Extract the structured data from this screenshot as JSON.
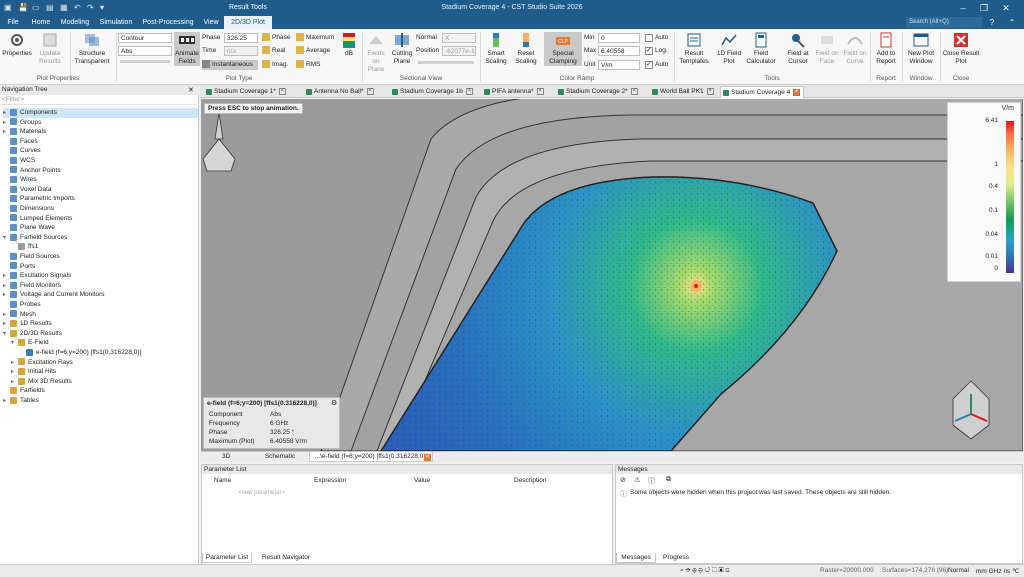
{
  "app": {
    "title": "Stadium Coverage 4 - CST Studio Suite 2026",
    "context_tab_group": "Result Tools",
    "search_placeholder": "Search (Alt+Q)"
  },
  "ribbon_tabs": [
    "File",
    "Home",
    "Modeling",
    "Simulation",
    "Post-Processing",
    "View",
    "2D/3D Plot"
  ],
  "ribbon": {
    "plot_properties": {
      "label": "Plot Properties",
      "properties": "Properties",
      "update_results": "Update Results"
    },
    "structure_transparent": "Structure Transparent",
    "contour_select": "Contour",
    "abs_select": "Abs",
    "animate_fields": "Animate Fields",
    "phase_label": "Phase",
    "phase_value": "326.25",
    "time_label": "Time",
    "time_value": "n/a",
    "instantaneous": "Instantaneous",
    "plot_type": {
      "label": "Plot Type",
      "phase": "Phase",
      "real": "Real",
      "imag": "Imag.",
      "maximum": "Maximum",
      "average": "Average",
      "rms": "RMS",
      "db": "dB"
    },
    "sectional_view": {
      "label": "Sectional View",
      "fields_on_plane": "Fields on Plane",
      "cutting_plane": "Cutting Plane",
      "normal_label": "Normal",
      "normal_value": "X",
      "position_label": "Position",
      "position_value": "-62077e-11"
    },
    "color_ramp": {
      "label": "Color Ramp",
      "smart_scaling": "Smart Scaling",
      "reset_scaling": "Reset Scaling",
      "special_clamping": "Special Clamping",
      "min_label": "Min",
      "min_value": "0",
      "max_label": "Max",
      "max_value": "6.40558",
      "unit_label": "Unit",
      "unit_value": "V/m",
      "auto1": "Auto",
      "log": "Log.",
      "auto2": "Auto"
    },
    "tools": {
      "label": "Tools",
      "result_templates": "Result Templates",
      "field_1d_plot": "1D Field Plot",
      "field_calculator": "Field Calculator",
      "field_at_cursor": "Field at Cursor",
      "field_on_face": "Field on Face",
      "field_on_curve": "Field on Curve"
    },
    "report": {
      "label": "Report",
      "add_to_report": "Add to Report"
    },
    "window": {
      "label": "Window",
      "new_plot_window": "New Plot Window"
    },
    "close": {
      "label": "Close",
      "close_result_plot": "Close Result Plot"
    }
  },
  "nav": {
    "title": "Navigation Tree",
    "filter": "<Filter>",
    "items": [
      {
        "label": "Components",
        "level": 0,
        "exp": "▸",
        "sel": true,
        "color": "#5b8fc9"
      },
      {
        "label": "Groups",
        "level": 0,
        "exp": "▸",
        "color": "#5b8fc9"
      },
      {
        "label": "Materials",
        "level": 0,
        "exp": "▸",
        "color": "#5b8fc9"
      },
      {
        "label": "Faces",
        "level": 0,
        "exp": "",
        "color": "#5b8fc9"
      },
      {
        "label": "Curves",
        "level": 0,
        "exp": "",
        "color": "#5b8fc9"
      },
      {
        "label": "WCS",
        "level": 0,
        "exp": "",
        "color": "#5b8fc9"
      },
      {
        "label": "Anchor Points",
        "level": 0,
        "exp": "",
        "color": "#5b8fc9"
      },
      {
        "label": "Wires",
        "level": 0,
        "exp": "",
        "color": "#5b8fc9"
      },
      {
        "label": "Voxel Data",
        "level": 0,
        "exp": "",
        "color": "#5b8fc9"
      },
      {
        "label": "Parametric Imports",
        "level": 0,
        "exp": "",
        "color": "#5b8fc9"
      },
      {
        "label": "Dimensions",
        "level": 0,
        "exp": "",
        "color": "#5b8fc9"
      },
      {
        "label": "Lumped Elements",
        "level": 0,
        "exp": "",
        "color": "#5b8fc9"
      },
      {
        "label": "Plane Wave",
        "level": 0,
        "exp": "",
        "color": "#5b8fc9"
      },
      {
        "label": "Farfield Sources",
        "level": 0,
        "exp": "▾",
        "color": "#5b8fc9"
      },
      {
        "label": "ffs1",
        "level": 1,
        "exp": "",
        "color": "#9a9a9a"
      },
      {
        "label": "Field Sources",
        "level": 0,
        "exp": "",
        "color": "#5b8fc9"
      },
      {
        "label": "Ports",
        "level": 0,
        "exp": "",
        "color": "#5b8fc9"
      },
      {
        "label": "Excitation Signals",
        "level": 0,
        "exp": "▸",
        "color": "#5b8fc9"
      },
      {
        "label": "Field Monitors",
        "level": 0,
        "exp": "▸",
        "color": "#5b8fc9"
      },
      {
        "label": "Voltage and Current Monitors",
        "level": 0,
        "exp": "▸",
        "color": "#5b8fc9"
      },
      {
        "label": "Probes",
        "level": 0,
        "exp": "",
        "color": "#5b8fc9"
      },
      {
        "label": "Mesh",
        "level": 0,
        "exp": "▸",
        "color": "#5b8fc9"
      },
      {
        "label": "1D Results",
        "level": 0,
        "exp": "▸",
        "color": "#d9a43b"
      },
      {
        "label": "2D/3D Results",
        "level": 0,
        "exp": "▾",
        "color": "#d9a43b"
      },
      {
        "label": "E-Field",
        "level": 1,
        "exp": "▾",
        "color": "#d9a43b"
      },
      {
        "label": "e-field (f=6;y=200) [ffs1(0.316228,0)]",
        "level": 2,
        "exp": "",
        "color": "#3a7ab8"
      },
      {
        "label": "Excitation Rays",
        "level": 1,
        "exp": "▸",
        "color": "#d9a43b"
      },
      {
        "label": "Initial Hits",
        "level": 1,
        "exp": "▸",
        "color": "#d9a43b"
      },
      {
        "label": "Mix 3D Results",
        "level": 1,
        "exp": "▸",
        "color": "#d9a43b"
      },
      {
        "label": "Farfields",
        "level": 0,
        "exp": "",
        "color": "#d9a43b"
      },
      {
        "label": "Tables",
        "level": 0,
        "exp": "▸",
        "color": "#d9a43b"
      }
    ]
  },
  "doc_tabs": [
    {
      "label": "Stadium Coverage 1*"
    },
    {
      "label": "Antenna No Ball*"
    },
    {
      "label": "Stadium Coverage 1b"
    },
    {
      "label": "PIFA antenna*"
    },
    {
      "label": "Stadium Coverage 2*"
    },
    {
      "label": "World Ball PK1"
    },
    {
      "label": "Stadium Coverage 4",
      "active": true
    }
  ],
  "viewport": {
    "esc_note": "Press ESC to stop animation.",
    "legend_unit": "V/m",
    "legend_ticks": [
      "6.41",
      "1",
      "0.4",
      "0.1",
      "0.04",
      "0.01",
      "0"
    ],
    "info": {
      "title": "e-field (f=6;y=200) [ffs1(0.316228,0)]",
      "rows": [
        {
          "k": "Component",
          "v": "Abs"
        },
        {
          "k": "Frequency",
          "v": "6 GHz"
        },
        {
          "k": "Phase",
          "v": "326.25 °"
        },
        {
          "k": "Maximum (Plot)",
          "v": "6.40558  V/m"
        }
      ]
    }
  },
  "view_tabs": [
    "3D",
    "Schematic",
    "...\\e-field (f=6;y=200) [ffs1(0.316228,0)]"
  ],
  "param_panel": {
    "title": "Parameter List",
    "cols": [
      "Name",
      "Expression",
      "Value",
      "Description"
    ],
    "new_param": "<new parameter>",
    "tabs": [
      "Parameter List",
      "Result Navigator"
    ]
  },
  "msg_panel": {
    "title": "Messages",
    "message": "Some objects were hidden when this project was last saved. These objects are still hidden.",
    "tabs": [
      "Messages",
      "Progress"
    ]
  },
  "status": {
    "raster": "Raster=20000.000",
    "surfaces": "Surfaces=174,276 (96)",
    "mode": "Normal",
    "units": "mm  GHz  ns  ℃"
  }
}
